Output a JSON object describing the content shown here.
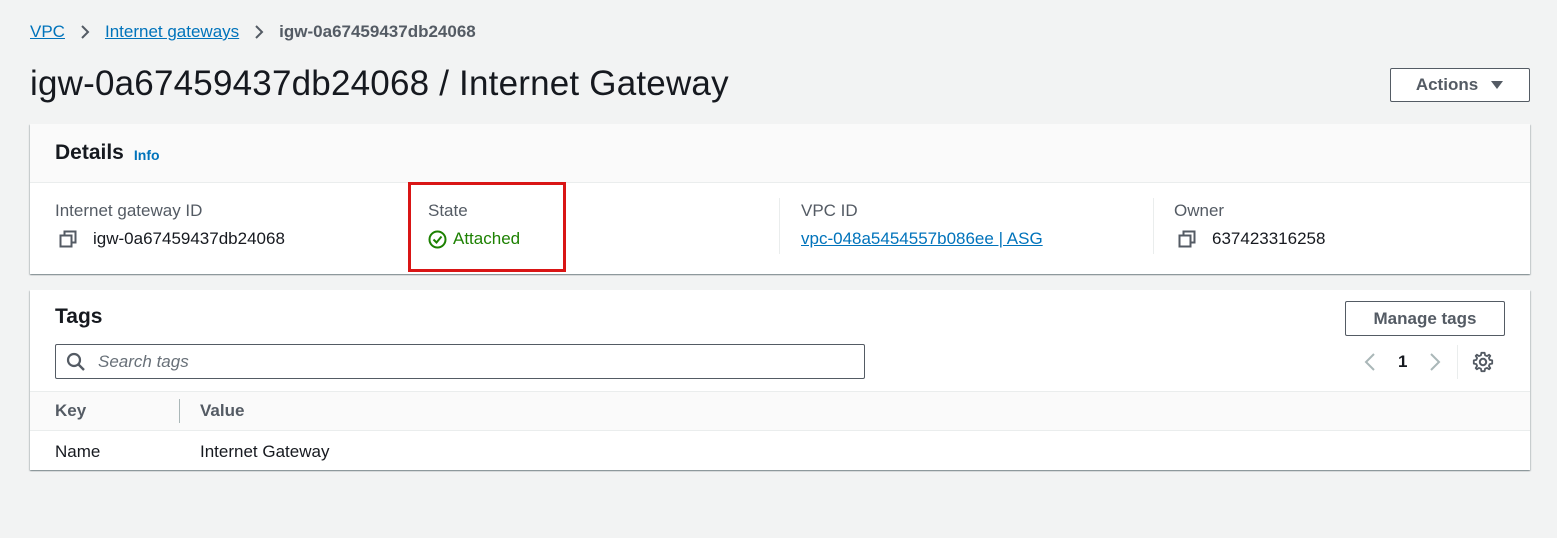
{
  "breadcrumb": {
    "items": [
      "VPC",
      "Internet gateways"
    ],
    "current": "igw-0a67459437db24068"
  },
  "page": {
    "title": "igw-0a67459437db24068 / Internet Gateway",
    "actions_label": "Actions"
  },
  "details": {
    "title": "Details",
    "info_label": "Info",
    "fields": {
      "igw_id": {
        "label": "Internet gateway ID",
        "value": "igw-0a67459437db24068"
      },
      "state": {
        "label": "State",
        "value": "Attached"
      },
      "vpc": {
        "label": "VPC ID",
        "value": "vpc-048a5454557b086ee | ASG"
      },
      "owner": {
        "label": "Owner",
        "value": "637423316258"
      }
    }
  },
  "tags": {
    "title": "Tags",
    "manage_label": "Manage tags",
    "search_placeholder": "Search tags",
    "page": "1",
    "columns": [
      "Key",
      "Value"
    ],
    "rows": [
      {
        "key": "Name",
        "value": "Internet Gateway"
      }
    ]
  },
  "colors": {
    "link": "#0073bb",
    "success": "#1d8102",
    "highlight": "#d91515",
    "background": "#f2f3f3"
  },
  "icons": {
    "breadcrumb_separator": "chevron-right-icon",
    "copy": "copy-icon",
    "state": "check-circle-icon",
    "search": "search-icon",
    "settings": "gear-icon"
  }
}
